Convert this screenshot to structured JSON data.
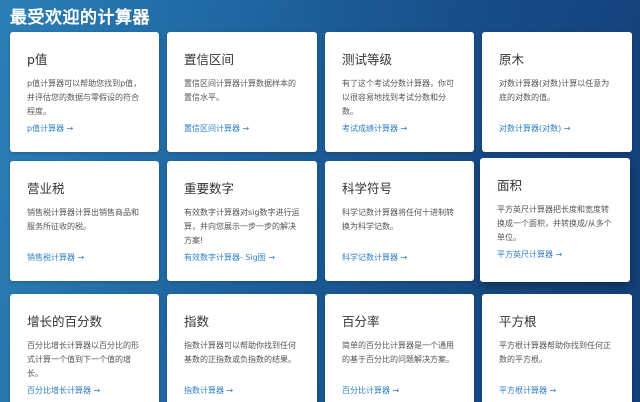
{
  "page": {
    "heading": "最受欢迎的计算器"
  },
  "cards": [
    {
      "title": "p值",
      "desc": "p值计算器可以帮助您找到p值，并评估您的数据与零假设的符合程度。",
      "link": "p值计算器 →"
    },
    {
      "title": "置信区间",
      "desc": "置信区间计算器计算数据样本的置信水平。",
      "link": "置信区间计算器 →"
    },
    {
      "title": "测试等级",
      "desc": "有了这个考试分数计算器，你可以很容易地找到考试分数和分数。",
      "link": "考试成绩计算器 →"
    },
    {
      "title": "原木",
      "desc": "对数计算器(对数)计算以任意为底的对数的值。",
      "link": "对数计算器(对数) →"
    },
    {
      "title": "营业税",
      "desc": "销售税计算器计算出销售商品和服务所征收的税。",
      "link": "销售税计算器 →"
    },
    {
      "title": "重要数字",
      "desc": "有效数字计算器对sig数字进行运算，并向您展示一步一步的解决方案!",
      "link": "有效数字计算器- Sig图 →"
    },
    {
      "title": "科学符号",
      "desc": "科学记数计算器将任何十进制转换为科学记数。",
      "link": "科学记数计算器 →"
    },
    {
      "title": "面积",
      "desc": "平方英尺计算器把长度和宽度转换成一个面积，并转换成/从多个单位。",
      "link": "平方英尺计算器 →"
    },
    {
      "title": "增长的百分数",
      "desc": "百分比增长计算器以百分比的形式计算一个值到下一个值的增长。",
      "link": "百分比增长计算器 →"
    },
    {
      "title": "指数",
      "desc": "指数计算器可以帮助你找到任何基数的正指数或负指数的结果。",
      "link": "指数计算器 →"
    },
    {
      "title": "百分率",
      "desc": "简单的百分比计算器是一个通用的基于百分比的问题解决方案。",
      "link": "百分比计算器 →"
    },
    {
      "title": "平方根",
      "desc": "平方根计算器帮助你找到任何正数的平方根。",
      "link": "平方根计算器 →"
    }
  ]
}
